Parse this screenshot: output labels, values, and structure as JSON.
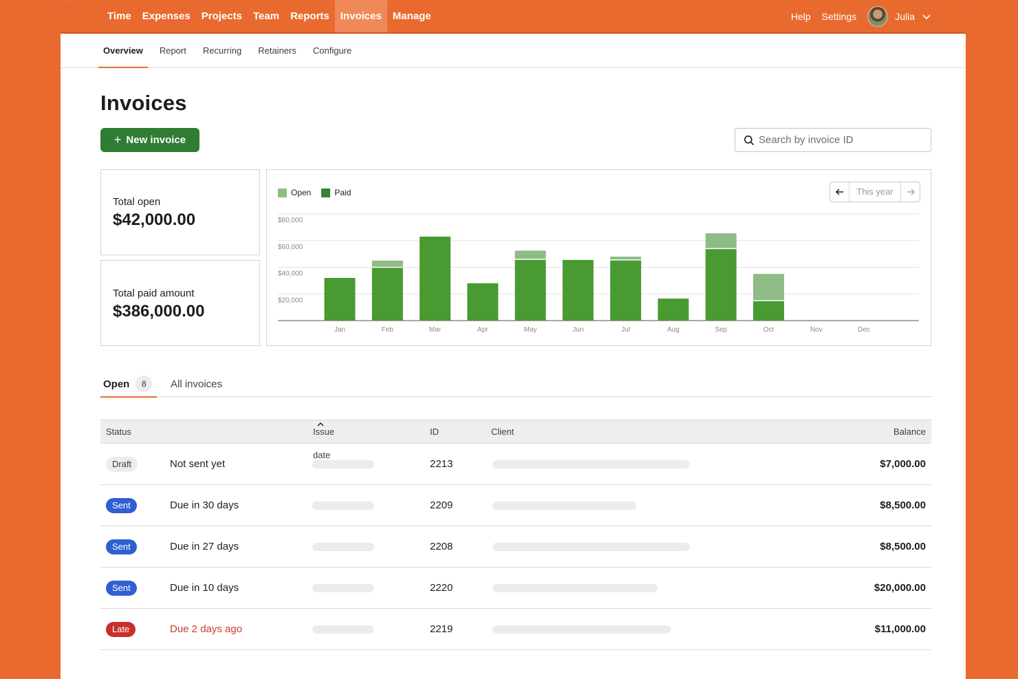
{
  "topnav": {
    "items": [
      {
        "label": "Time",
        "active": false
      },
      {
        "label": "Expenses",
        "active": false
      },
      {
        "label": "Projects",
        "active": false
      },
      {
        "label": "Team",
        "active": false
      },
      {
        "label": "Reports",
        "active": false
      },
      {
        "label": "Invoices",
        "active": true
      },
      {
        "label": "Manage",
        "active": false
      }
    ],
    "help": "Help",
    "settings": "Settings",
    "user": "Julia"
  },
  "subnav": {
    "items": [
      {
        "label": "Overview",
        "active": true
      },
      {
        "label": "Report",
        "active": false
      },
      {
        "label": "Recurring",
        "active": false
      },
      {
        "label": "Retainers",
        "active": false
      },
      {
        "label": "Configure",
        "active": false
      }
    ]
  },
  "page": {
    "title": "Invoices",
    "new_invoice_label": "New invoice",
    "search_placeholder": "Search by invoice ID"
  },
  "stats": {
    "open_label": "Total open",
    "open_value": "$42,000.00",
    "paid_label": "Total paid amount",
    "paid_value": "$386,000.00"
  },
  "period": {
    "label": "This year"
  },
  "colors": {
    "brand": "#e96a2e",
    "paid": "#4a9a32",
    "open": "#8fbb86",
    "primary_button": "#2f7d32",
    "sent": "#2f5fd1",
    "late": "#c7302b"
  },
  "chart_data": {
    "type": "bar",
    "stacked": true,
    "categories": [
      "Jan",
      "Feb",
      "Mar",
      "Apr",
      "May",
      "Jun",
      "Jul",
      "Aug",
      "Sep",
      "Oct",
      "Nov",
      "Dec"
    ],
    "series": [
      {
        "name": "Paid",
        "color": "#4a9a32",
        "values": [
          32000,
          40000,
          63000,
          28000,
          46000,
          45500,
          45500,
          16500,
          54000,
          15000,
          0,
          0
        ]
      },
      {
        "name": "Open",
        "color": "#8fbb86",
        "values": [
          0,
          5000,
          0,
          0,
          6500,
          0,
          2500,
          0,
          11500,
          20000,
          0,
          0
        ]
      }
    ],
    "yticks": [
      "$20,000",
      "$40,000",
      "$60,000",
      "$80,000"
    ],
    "ylim": [
      0,
      80000
    ],
    "grid": true,
    "legend": "top-left"
  },
  "tabs": {
    "open_label": "Open",
    "open_count": "8",
    "all_label": "All invoices"
  },
  "table": {
    "headers": {
      "status": "Status",
      "issue_date": "Issue date",
      "id": "ID",
      "client": "Client",
      "balance": "Balance"
    },
    "rows": [
      {
        "status": "Draft",
        "status_kind": "draft",
        "due": "Not sent yet",
        "id": "2213",
        "balance": "$7,000.00"
      },
      {
        "status": "Sent",
        "status_kind": "sent",
        "due": "Due in 30 days",
        "id": "2209",
        "balance": "$8,500.00"
      },
      {
        "status": "Sent",
        "status_kind": "sent",
        "due": "Due in 27 days",
        "id": "2208",
        "balance": "$8,500.00"
      },
      {
        "status": "Sent",
        "status_kind": "sent",
        "due": "Due in 10 days",
        "id": "2220",
        "balance": "$20,000.00"
      },
      {
        "status": "Late",
        "status_kind": "late",
        "due": "Due 2 days ago",
        "id": "2219",
        "balance": "$11,000.00"
      }
    ]
  }
}
